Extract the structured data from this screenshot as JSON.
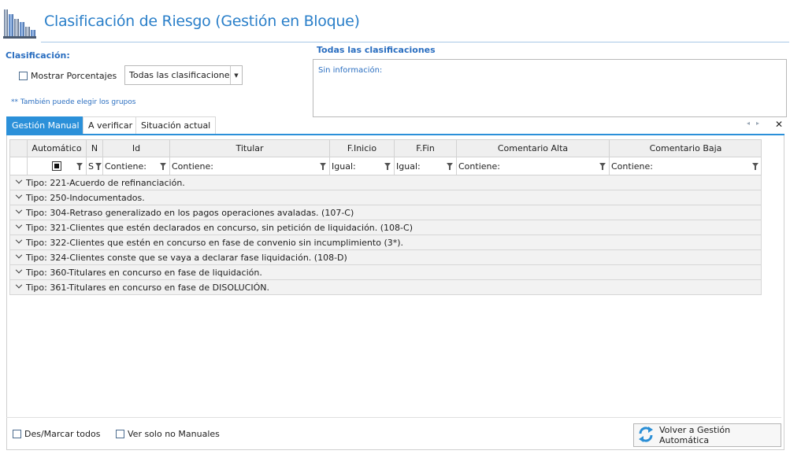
{
  "header": {
    "title": "Clasificación de Riesgo (Gestión en Bloque)",
    "icon": "bar-chart-icon"
  },
  "clasificacion": {
    "label": "Clasificación:",
    "mostrar_porcentajes_label": "Mostrar Porcentajes",
    "select_value": "Todas las clasificaciones",
    "hint": "** También puede elegir los grupos"
  },
  "info_panel": {
    "title": "Todas las clasificaciones",
    "text": "Sin información:"
  },
  "tabs": [
    {
      "label": "Gestión Manual",
      "active": true
    },
    {
      "label": "A verificar",
      "active": false
    },
    {
      "label": "Situación actual",
      "active": false
    }
  ],
  "tab_controls": {
    "prev": "◂",
    "next": "▸",
    "close": "✕"
  },
  "grid": {
    "columns": [
      "Automático",
      "N",
      "Id",
      "Titular",
      "F.Inicio",
      "F.Fin",
      "Comentario Alta",
      "Comentario Baja"
    ],
    "filters": {
      "n": "S",
      "id": "Contiene:",
      "titular": "Contiene:",
      "finicio": "Igual:",
      "ffin": "Igual:",
      "com_alta": "Contiene:",
      "com_baja": "Contiene:"
    },
    "groups": [
      "Tipo: 221-Acuerdo de refinanciación.",
      "Tipo: 250-Indocumentados.",
      "Tipo: 304-Retraso generalizado en los pagos operaciones avaladas. (107-C)",
      "Tipo: 321-Clientes que estén declarados en concurso, sin petición de liquidación. (108-C)",
      "Tipo: 322-Clientes que estén en concurso en fase de convenio sin incumplimiento (3*).",
      "Tipo: 324-Clientes conste que se vaya a declarar fase liquidación. (108-D)",
      "Tipo: 360-Titulares en concurso en fase de liquidación.",
      "Tipo: 361-Titulares en concurso en fase de  DISOLUCIÓN."
    ]
  },
  "footer": {
    "desmarcar_label": "Des/Marcar todos",
    "solo_manuales_label": "Ver solo no Manuales",
    "volver_button": "Volver a Gestión Automática"
  },
  "colors": {
    "accent": "#2b90d9",
    "title": "#2a7fc9",
    "label": "#2a6ec0"
  }
}
